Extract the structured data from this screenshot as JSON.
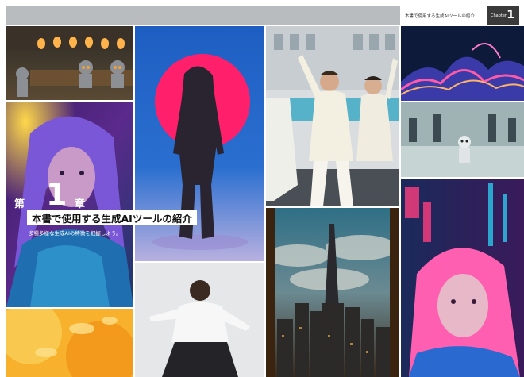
{
  "header": {
    "running_title": "本書で使用する生成AIツールの紹介",
    "chapter_label": "Chapter",
    "chapter_number": "1"
  },
  "chapter": {
    "prefix": "第",
    "number": "1",
    "suffix": "章",
    "title": "本書で使用する生成AIツールの紹介",
    "subtitle": "多種多様な生成AIの特徴を把握しよう。"
  },
  "colors": {
    "top_band": "#b8bcbe",
    "chapter_badge": "#3a3a3a",
    "accent_pink": "#ff1f6b",
    "accent_cyan": "#1fb6ff"
  }
}
